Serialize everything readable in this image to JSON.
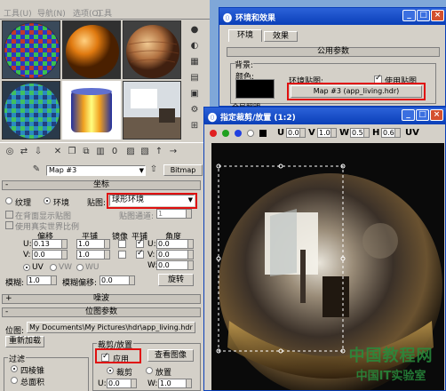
{
  "menu": {
    "items": [
      "工具(U)",
      "导航(N)",
      "选项(O)",
      "工具"
    ]
  },
  "material_editor": {
    "map_name": "Map #3",
    "map_type": "Bitmap",
    "coord_rollout": "坐标",
    "texture_label": "纹理",
    "environ_label": "环境",
    "mapping_label": "贴图:",
    "mapping_value": "球形环境",
    "show_bg_label": "在背面显示贴图",
    "map_channel_label": "贴图通道:",
    "map_channel_value": "1",
    "real_world_label": "使用真实世界比例",
    "col_offset": "偏移",
    "col_tiling": "平铺",
    "col_mirror": "镜像",
    "col_tile": "平铺",
    "col_angle": "角度",
    "u_label": "U:",
    "v_label": "V:",
    "w_label": "W:",
    "u_offset": "0.13",
    "v_offset": "0.0",
    "u_tiling": "1.0",
    "v_tiling": "1.0",
    "u_angle": "0.0",
    "v_angle": "0.0",
    "w_angle": "0.0",
    "uv_label": "UV",
    "vw_label": "VW",
    "wu_label": "WU",
    "blur_label": "模糊:",
    "blur_value": "1.0",
    "blur_offset_label": "模糊偏移:",
    "blur_offset_value": "0.0",
    "rotate_label": "旋转",
    "noise_rollout": "噪波",
    "bitmap_rollout": "位图参数",
    "bitmap_label": "位图:",
    "bitmap_path": "My Documents\\My Pictures\\hdr\\app_living.hdr",
    "reload_label": "重新加载",
    "crop_group": "裁剪/放置",
    "apply_label": "应用",
    "view_image_label": "查看图像",
    "crop_label": "裁剪",
    "place_label": "放置",
    "filter_group": "过滤",
    "quad_label": "四棱锥",
    "summed_label": "总面积",
    "u_bottom": "0.0",
    "w_bottom": "1.0"
  },
  "env_dialog": {
    "title": "环境和效果",
    "tab_env": "环境",
    "tab_effects": "效果",
    "common_params": "公用参数",
    "background": "背景:",
    "color": "颜色:",
    "env_map": "环境贴图:",
    "use_map": "使用贴图",
    "map_button": "Map #3 (app_living.hdr)",
    "global_light": "全局照明"
  },
  "crop_window": {
    "title": "指定裁剪/放置 (1:2)",
    "u_label": "U",
    "u_val": "0.0",
    "v_label": "V",
    "v_val": "1.0",
    "w_label": "W",
    "w_val": "0.5",
    "h_label": "H",
    "h_val": "0.6",
    "uv_toggle": "UV"
  },
  "watermark": {
    "line1": "中国教程网",
    "line2": "中国IT实验室"
  },
  "colors": {
    "highlight": "#e01010",
    "titlebar": "#0a3fb8",
    "panel": "#d4d0c8"
  }
}
